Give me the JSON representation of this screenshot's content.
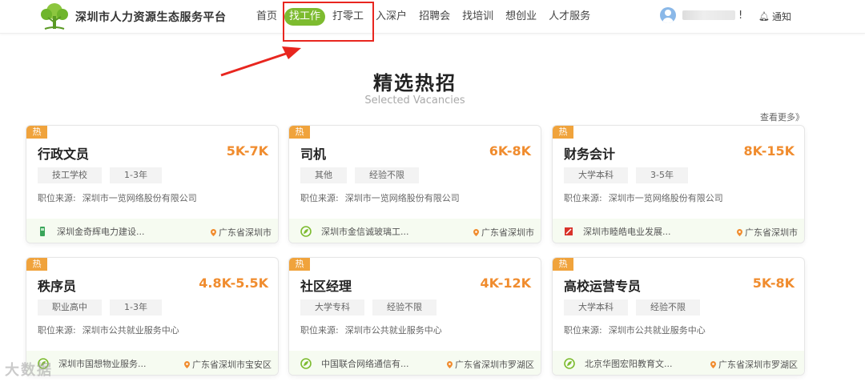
{
  "header": {
    "site_title": "深圳市人力资源生态服务平台",
    "nav": [
      {
        "label": "首页",
        "active": false
      },
      {
        "label": "找工作",
        "active": true
      },
      {
        "label": "打零工",
        "active": false
      },
      {
        "label": "入深户",
        "active": false
      },
      {
        "label": "招聘会",
        "active": false
      },
      {
        "label": "找培训",
        "active": false
      },
      {
        "label": "想创业",
        "active": false
      },
      {
        "label": "人才服务",
        "active": false
      }
    ],
    "greeting_prefix": "您",
    "greeting_suffix": "!",
    "notify_label": "通知"
  },
  "section": {
    "title": "精选热招",
    "subtitle": "Selected Vacancies",
    "more_label": "查看更多》"
  },
  "labels": {
    "hot": "热",
    "source_prefix": "职位来源:"
  },
  "cards": [
    {
      "title": "行政文员",
      "salary": "5K-7K",
      "tags": [
        "技工学校",
        "1-3年"
      ],
      "source": "深圳市一览网络股份有限公司",
      "company": "深圳金奇辉电力建设...",
      "location": "广东省深圳市",
      "company_icon": "green-bar-icon"
    },
    {
      "title": "司机",
      "salary": "6K-8K",
      "tags": [
        "其他",
        "经验不限"
      ],
      "source": "深圳市一览网络股份有限公司",
      "company": "深圳市金信诚玻璃工...",
      "location": "广东省深圳市",
      "company_icon": "leaf-icon"
    },
    {
      "title": "财务会计",
      "salary": "8K-15K",
      "tags": [
        "大学本科",
        "3-5年"
      ],
      "source": "深圳市一览网络股份有限公司",
      "company": "深圳市睦皓电业发展...",
      "location": "广东省深圳市",
      "company_icon": "red-logo-icon"
    },
    {
      "title": "秩序员",
      "salary": "4.8K-5.5K",
      "tags": [
        "职业高中",
        "1-3年"
      ],
      "source": "深圳市公共就业服务中心",
      "company": "深圳市国想物业服务...",
      "location": "广东省深圳市宝安区",
      "company_icon": "leaf-icon"
    },
    {
      "title": "社区经理",
      "salary": "4K-12K",
      "tags": [
        "大学专科",
        "经验不限"
      ],
      "source": "深圳市公共就业服务中心",
      "company": "中国联合网络通信有...",
      "location": "广东省深圳市罗湖区",
      "company_icon": "leaf-icon"
    },
    {
      "title": "高校运营专员",
      "salary": "5K-8K",
      "tags": [
        "大学本科",
        "经验不限"
      ],
      "source": "深圳市公共就业服务中心",
      "company": "北京华图宏阳教育文...",
      "location": "广东省深圳市罗湖区",
      "company_icon": "leaf-icon"
    }
  ],
  "watermark": "大数据",
  "colors": {
    "accent_green": "#7dbb2f",
    "salary_orange": "#f08c2e",
    "hot_badge": "#f0a33c",
    "annotation_red": "#e8261f"
  }
}
